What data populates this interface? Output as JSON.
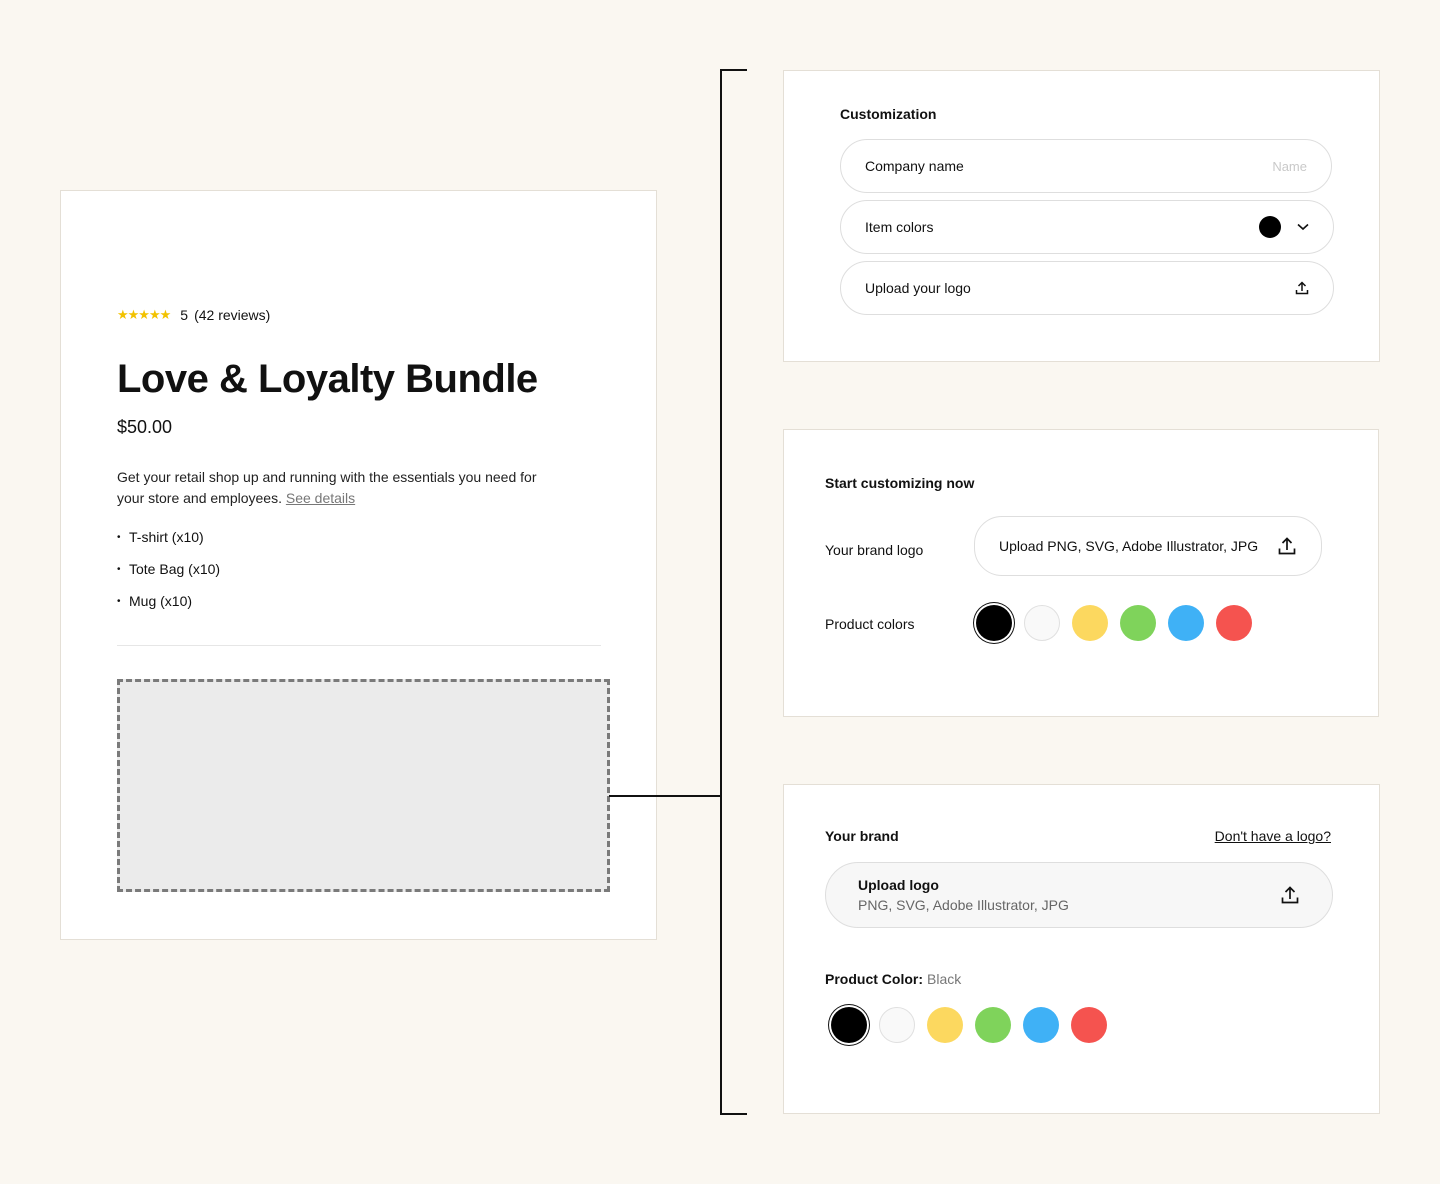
{
  "product": {
    "stars": "★★★★★",
    "rating": "5",
    "reviews": "(42 reviews)",
    "title": "Love & Loyalty Bundle",
    "price": "$50.00",
    "description": "Get your retail shop up and running with the essentials you need for your store and employees.",
    "details_link": "See details",
    "items": [
      "T-shirt (x10)",
      "Tote Bag (x10)",
      "Mug (x10)"
    ]
  },
  "variant_a": {
    "title": "Customization",
    "company_label": "Company name",
    "company_placeholder": "Name",
    "colors_label": "Item colors",
    "upload_label": "Upload your logo"
  },
  "variant_b": {
    "title": "Start customizing now",
    "logo_label": "Your brand logo",
    "upload_text": "Upload PNG, SVG, Adobe Illustrator, JPG",
    "colors_label": "Product colors"
  },
  "variant_c": {
    "title": "Your brand",
    "no_logo_link": "Don't have a logo?",
    "upload_title": "Upload logo",
    "upload_formats": "PNG, SVG, Adobe Illustrator, JPG",
    "color_label": "Product Color:",
    "color_value": "Black"
  },
  "colors": [
    "#000000",
    "#f9f9f9",
    "#fcd85f",
    "#7fd35b",
    "#3fb1f6",
    "#f5534f"
  ]
}
